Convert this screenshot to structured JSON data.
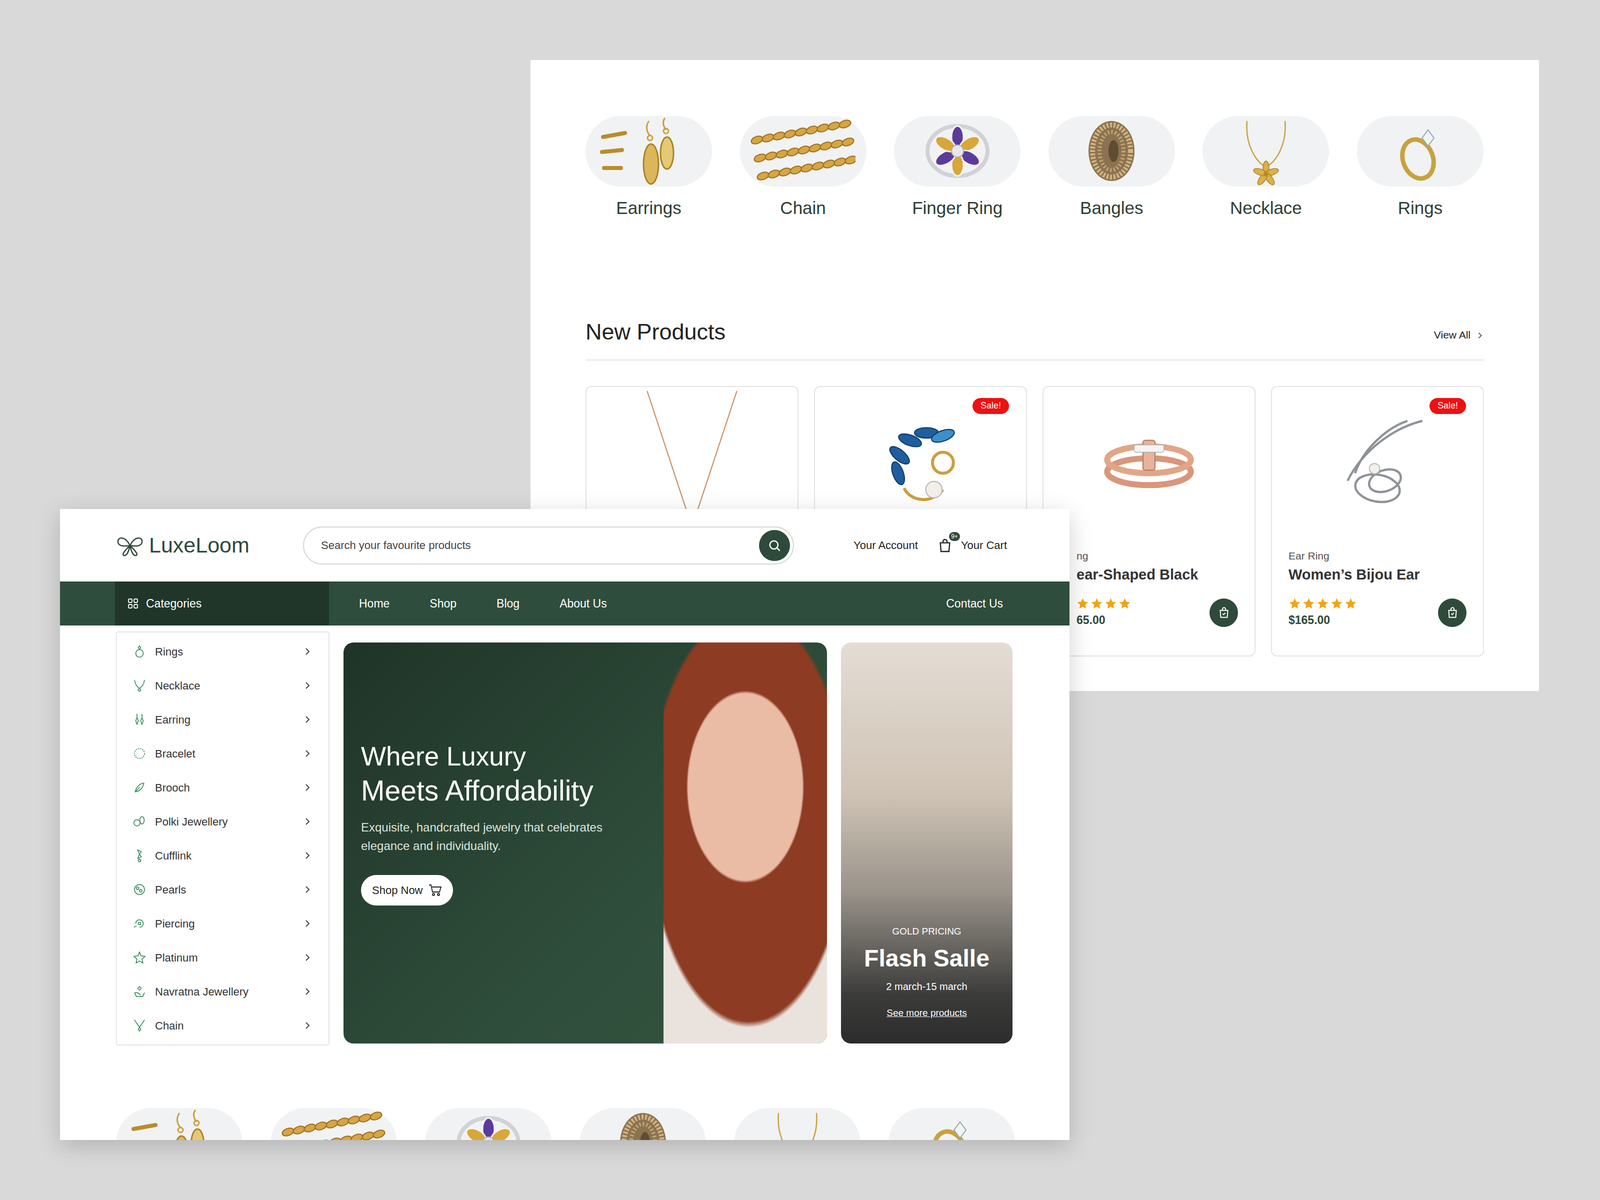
{
  "header": {
    "logo": "LuxeLoom",
    "search": {
      "placeholder": "Search your favourite products"
    },
    "account": "Your Account",
    "cart": {
      "label": "Your Cart",
      "badge": "9+"
    }
  },
  "nav": {
    "categories": "Categories",
    "links": [
      "Home",
      "Shop",
      "Blog",
      "About Us"
    ],
    "contact": "Contact Us"
  },
  "sidebar": {
    "items": [
      "Rings",
      "Necklace",
      "Earring",
      "Bracelet",
      "Brooch",
      "Polki Jewellery",
      "Cufflink",
      "Pearls",
      "Piercing",
      "Platinum",
      "Navratna Jewellery",
      "Chain"
    ]
  },
  "hero": {
    "title_light": "Where Luxury",
    "title": "Meets Affordability",
    "text": "Exquisite, handcrafted jewelry that celebrates elegance and individuality.",
    "button": "Shop Now"
  },
  "promo": {
    "eyebrow": "GOLD PRICING",
    "title": "Flash Salle",
    "dates": "2 march-15 march",
    "link": "See more products"
  },
  "categories": [
    {
      "label": "Earrings"
    },
    {
      "label": "Chain"
    },
    {
      "label": "Finger Ring"
    },
    {
      "label": "Bangles"
    },
    {
      "label": "Necklace"
    },
    {
      "label": "Rings"
    }
  ],
  "back": {
    "section": {
      "title": "New Products",
      "link": "View All"
    },
    "products": [
      {},
      {
        "badge": "Sale!"
      },
      {
        "category": "ng",
        "title": "ear-Shaped Black",
        "stars": 4,
        "price": "65.00"
      },
      {
        "badge": "Sale!",
        "category": "Ear Ring",
        "title": "Women’s Bijou Ear",
        "stars": 5,
        "price": "$165.00"
      }
    ]
  }
}
